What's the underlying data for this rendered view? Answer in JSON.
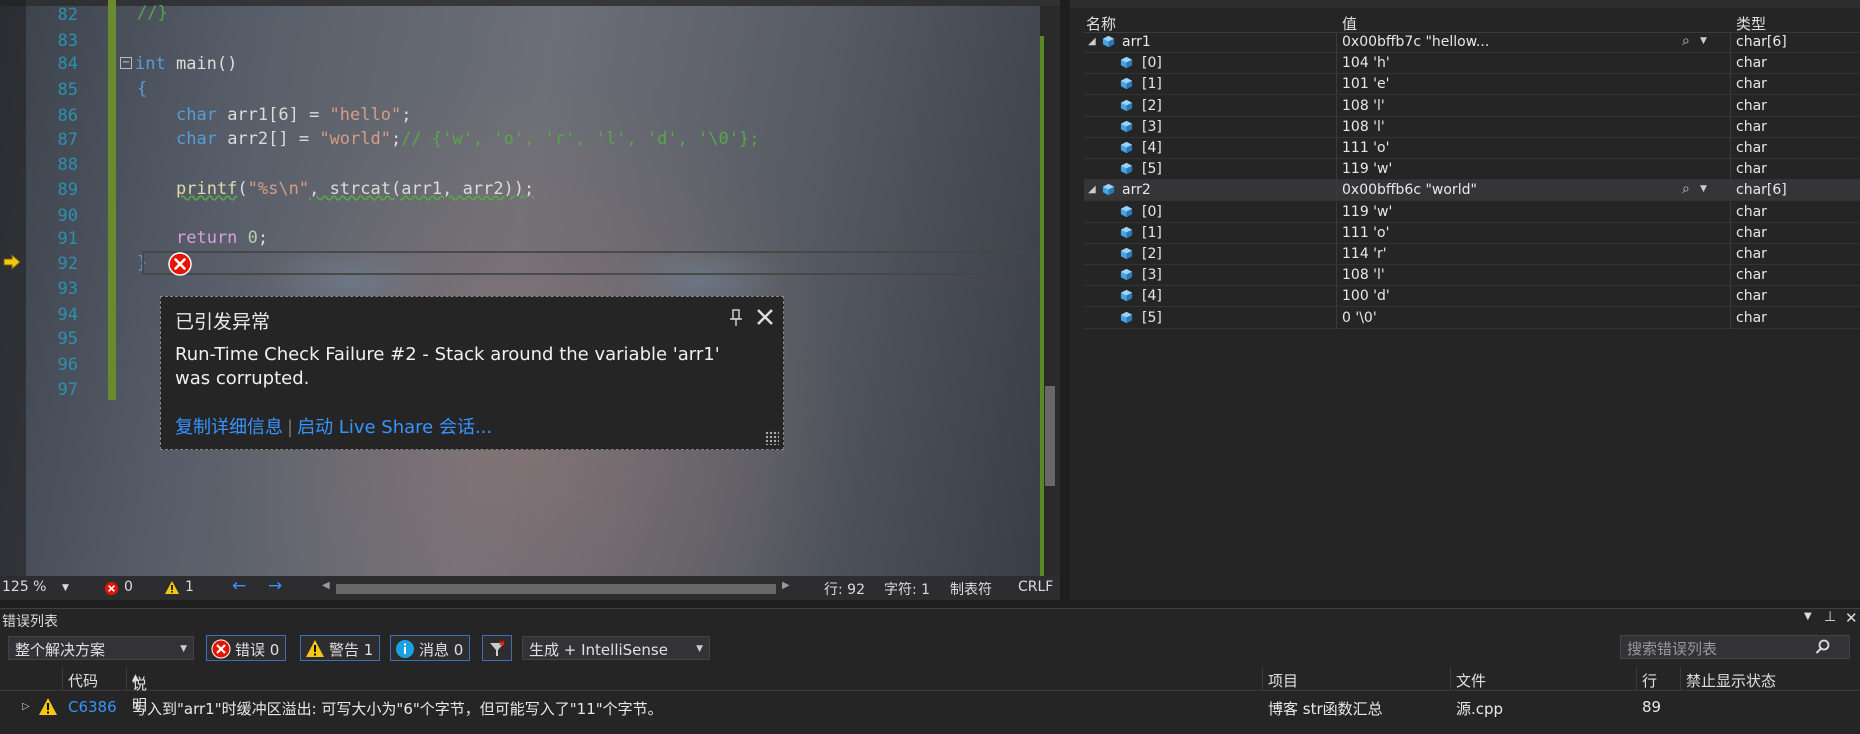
{
  "editor": {
    "line_numbers": [
      "82",
      "83",
      "84",
      "85",
      "86",
      "87",
      "88",
      "89",
      "90",
      "91",
      "92",
      "93",
      "94",
      "95",
      "96",
      "97"
    ],
    "code": {
      "l82": "//}",
      "l84_kw": "int",
      "l84_rest": " main()",
      "l85": "{",
      "l86_kw": "char",
      "l86_id": " arr1[6] = ",
      "l86_str": "\"hello\"",
      "l86_end": ";",
      "l87_kw": "char",
      "l87_id": " arr2[] = ",
      "l87_str": "\"world\"",
      "l87_end": ";",
      "l87_cm": "// {'w', 'o', 'r', 'l', 'd', '\\0'};",
      "l89_fn": "printf",
      "l89_open": "(",
      "l89_str": "\"%s\\n\"",
      "l89_rest": ", strcat(arr1, arr2));",
      "l91_kw": "return",
      "l91_num": " 0",
      "l91_end": ";",
      "l92": "}"
    },
    "status": {
      "zoom": "125 %",
      "errors": "0",
      "warnings": "1",
      "line": "行: 92",
      "char": "字符: 1",
      "tabs": "制表符",
      "eol": "CRLF"
    }
  },
  "exception": {
    "title": "已引发异常",
    "message": "Run-Time Check Failure #2 - Stack around the variable 'arr1' was corrupted.",
    "link_copy": "复制详细信息",
    "link_share": "启动 Live Share 会话..."
  },
  "watch": {
    "headers": {
      "name": "名称",
      "value": "值",
      "type": "类型"
    },
    "arr1": {
      "name": "arr1",
      "value": "0x00bffb7c \"hellow...",
      "type": "char[6]",
      "items": [
        {
          "name": "[0]",
          "value": "104 'h'",
          "type": "char"
        },
        {
          "name": "[1]",
          "value": "101 'e'",
          "type": "char"
        },
        {
          "name": "[2]",
          "value": "108 'l'",
          "type": "char"
        },
        {
          "name": "[3]",
          "value": "108 'l'",
          "type": "char"
        },
        {
          "name": "[4]",
          "value": "111 'o'",
          "type": "char"
        },
        {
          "name": "[5]",
          "value": "119 'w'",
          "type": "char"
        }
      ]
    },
    "arr2": {
      "name": "arr2",
      "value": "0x00bffb6c \"world\"",
      "type": "char[6]",
      "items": [
        {
          "name": "[0]",
          "value": "119 'w'",
          "type": "char"
        },
        {
          "name": "[1]",
          "value": "111 'o'",
          "type": "char"
        },
        {
          "name": "[2]",
          "value": "114 'r'",
          "type": "char"
        },
        {
          "name": "[3]",
          "value": "108 'l'",
          "type": "char"
        },
        {
          "name": "[4]",
          "value": "100 'd'",
          "type": "char"
        },
        {
          "name": "[5]",
          "value": "0 '\\0'",
          "type": "char"
        }
      ]
    }
  },
  "errlist": {
    "title": "错误列表",
    "scope": "整个解决方案",
    "btn_errors": "错误 0",
    "btn_warnings": "警告 1",
    "btn_messages": "消息 0",
    "build_filter": "生成 + IntelliSense",
    "search_placeholder": "搜索错误列表",
    "columns": {
      "code": "代码",
      "desc": "说明",
      "project": "项目",
      "file": "文件",
      "line": "行",
      "suppress": "禁止显示状态"
    },
    "row": {
      "code": "C6386",
      "desc": "写入到\"arr1\"时缓冲区溢出: 可写大小为\"6\"个字节，但可能写入了\"11\"个字节。",
      "project": "博客 str函数汇总",
      "file": "源.cpp",
      "line": "89"
    }
  },
  "colors": {
    "keyword": "#569cd6",
    "string": "#d69d85",
    "comment": "#57a64a",
    "link": "#3794ff",
    "error": "#e51400",
    "warning": "#f2c811"
  }
}
